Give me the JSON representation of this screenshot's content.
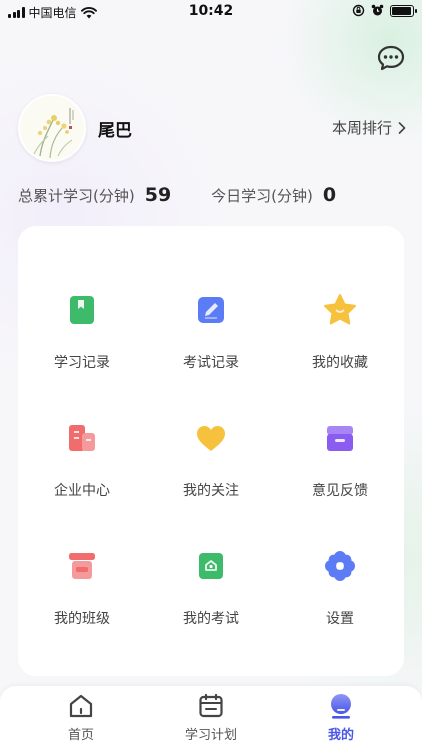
{
  "status_bar": {
    "carrier": "中国电信",
    "time": "10:42",
    "battery_level": 0.95
  },
  "header": {
    "message_icon": "chat-bubble-icon"
  },
  "profile": {
    "name": "尾巴",
    "rank_label": "本周排行"
  },
  "stats": {
    "total_label": "总累计学习(分钟)",
    "total_value": "59",
    "today_label": "今日学习(分钟)",
    "today_value": "0"
  },
  "grid": [
    {
      "label": "学习记录",
      "icon": "bookmark-icon",
      "color": "#3dbb6a"
    },
    {
      "label": "考试记录",
      "icon": "pen-note-icon",
      "color": "#5b7cf5"
    },
    {
      "label": "我的收藏",
      "icon": "star-icon",
      "color": "#f6c23e"
    },
    {
      "label": "企业中心",
      "icon": "building-icon",
      "color": "#f16d6d"
    },
    {
      "label": "我的关注",
      "icon": "heart-icon",
      "color": "#f6c23e"
    },
    {
      "label": "意见反馈",
      "icon": "inbox-icon",
      "color": "#8a5cf0"
    },
    {
      "label": "我的班级",
      "icon": "signboard-icon",
      "color": "#f16d6d"
    },
    {
      "label": "我的考试",
      "icon": "exam-doc-icon",
      "color": "#3dbb6a"
    },
    {
      "label": "设置",
      "icon": "flower-gear-icon",
      "color": "#5b7cf5"
    }
  ],
  "tabs": [
    {
      "label": "首页",
      "icon": "home-icon",
      "active": false
    },
    {
      "label": "学习计划",
      "icon": "calendar-icon",
      "active": false
    },
    {
      "label": "我的",
      "icon": "profile-icon",
      "active": true
    }
  ],
  "colors": {
    "accent": "#4a56e8"
  }
}
